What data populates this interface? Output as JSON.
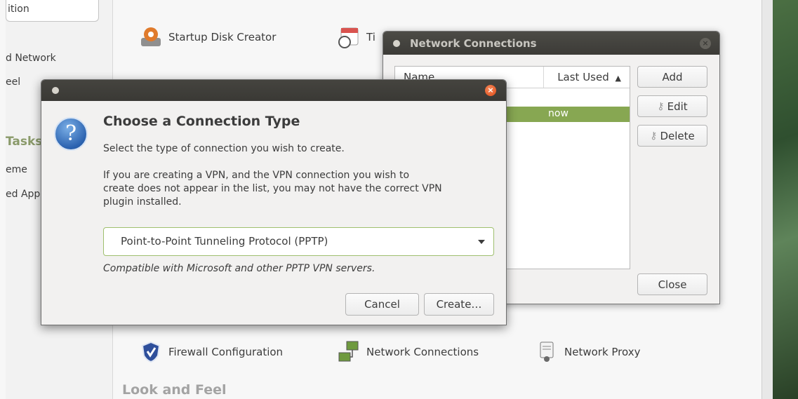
{
  "sidebar": {
    "search_value": "ition",
    "item_network": "d Network",
    "item_feel": "eel",
    "heading_tasks": "Tasks",
    "item_theme": "eme",
    "item_apps": "ed App"
  },
  "apps": {
    "startup_disk": "Startup Disk Creator",
    "time_partial": "Ti",
    "firewall": "Firewall Configuration",
    "network_connections": "Network Connections",
    "network_proxy": "Network Proxy"
  },
  "sections": {
    "look_and_feel": "Look and Feel"
  },
  "network_window": {
    "title": "Network Connections",
    "col_name": "Name",
    "col_last_used": "Last Used",
    "sort_indicator": "▲",
    "row_last_used": "now",
    "add_label": "Add",
    "edit_label": "Edit",
    "delete_label": "Delete",
    "close_label": "Close"
  },
  "dialog": {
    "heading": "Choose a Connection Type",
    "subtitle": "Select the type of connection you wish to create.",
    "info_line1": "If you are creating a VPN, and the VPN connection you wish to",
    "info_line2": "create does not appear in the list, you may not have the correct VPN",
    "info_line3": "plugin installed.",
    "selected_type": "Point-to-Point Tunneling Protocol (PPTP)",
    "hint": "Compatible with Microsoft and other PPTP VPN servers.",
    "cancel_label": "Cancel",
    "create_label": "Create…",
    "help_glyph": "?",
    "close_glyph": "×"
  },
  "icons": {
    "question": "question-icon",
    "key": "key-icon"
  }
}
